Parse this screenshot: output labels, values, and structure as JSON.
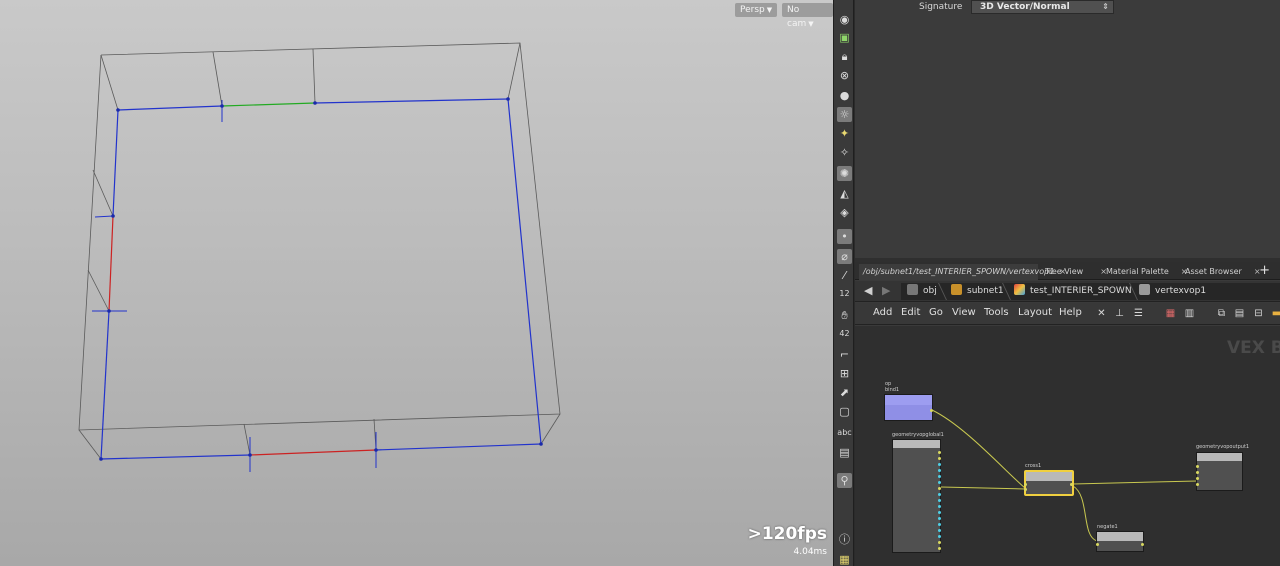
{
  "viewport": {
    "persp_label": "Persp",
    "cam_label": "No cam",
    "fps": ">120fps",
    "ms": "4.04ms"
  },
  "shelf": {
    "icons": [
      "eye-icon",
      "display-icon",
      "lock-icon",
      "ghost-icon",
      "sphere-icon",
      "light-bulb-icon",
      "light-icon",
      "point-light-icon",
      "lighting-icon",
      "camera-icon",
      "render-icon",
      "point-icon",
      "brush-icon",
      "wand-icon",
      "number-icon",
      "hand-icon",
      "measure-icon",
      "bracket-icon",
      "snap-icon",
      "uv-icon",
      "square-icon",
      "text-icon",
      "image-icon",
      "display-option-icon",
      "info-icon",
      "grid-icon"
    ],
    "text_abc": "abc",
    "text_12": "12",
    "text_42": "42"
  },
  "params": {
    "signature_label": "Signature",
    "signature_value": "3D Vector/Normal"
  },
  "tabs": [
    {
      "label": "/obj/subnet1/test_INTERIER_SPOWN/vertexvop1",
      "close": "×"
    },
    {
      "label": "Tree View",
      "close": "×"
    },
    {
      "label": "Material Palette",
      "close": "×"
    },
    {
      "label": "Asset Browser",
      "close": "×"
    }
  ],
  "tab_add": "+",
  "breadcrumbs": [
    "obj",
    "subnet1",
    "test_INTERIER_SPOWN",
    "vertexvop1"
  ],
  "menu": [
    "Add",
    "Edit",
    "Go",
    "View",
    "Tools",
    "Layout",
    "Help"
  ],
  "network": {
    "watermark": "VEX Bu",
    "nodes": {
      "bind1": {
        "tag": "op",
        "name": "bind1"
      },
      "global": {
        "name": "geometryvopglobal1"
      },
      "cross": {
        "name": "cross1"
      },
      "output": {
        "name": "geometryvopoutput1"
      },
      "negate": {
        "name": "negate1"
      }
    }
  },
  "colors": {
    "bind_node": "#8f8fe6",
    "selected_node": "#f0d040",
    "wire": "#c8c850",
    "edge_blue": "#2233cc",
    "edge_red": "#cc2222",
    "edge_green": "#22aa22"
  }
}
